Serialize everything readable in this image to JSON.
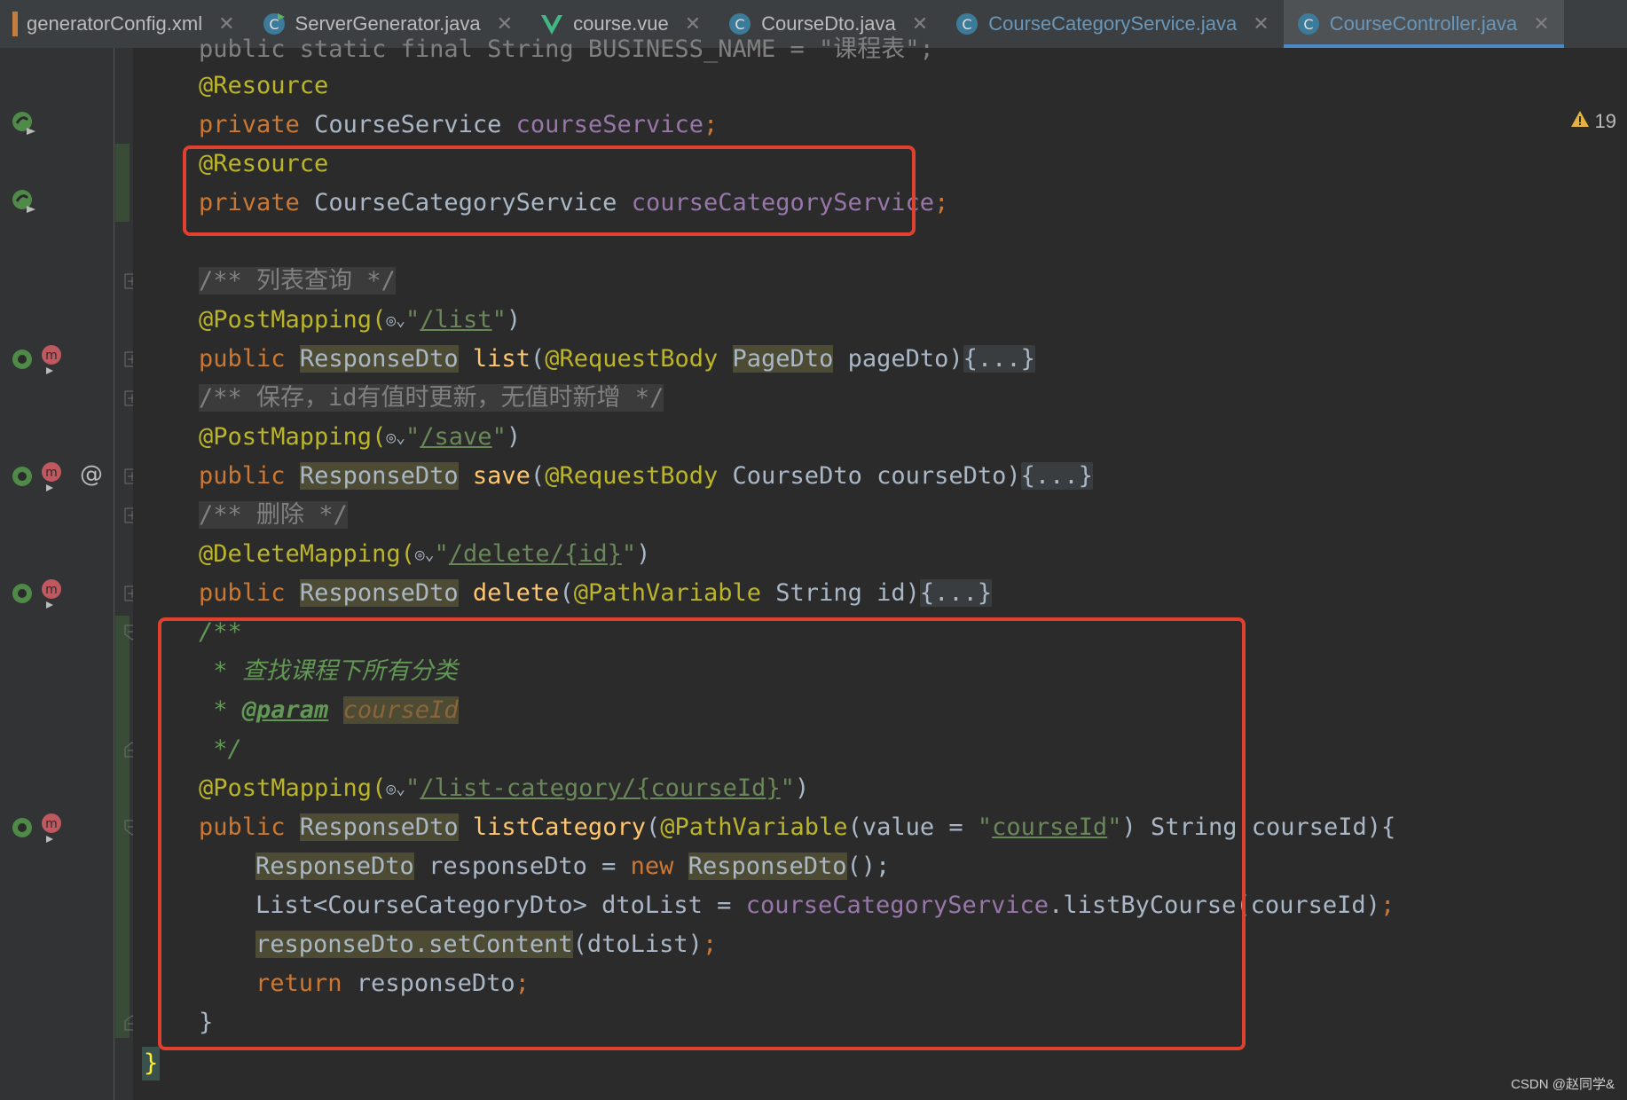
{
  "tabs": [
    {
      "label": "generatorConfig.xml",
      "icon": "xml-file-icon"
    },
    {
      "label": "ServerGenerator.java",
      "icon": "java-runnable-icon"
    },
    {
      "label": "course.vue",
      "icon": "vue-file-icon"
    },
    {
      "label": "CourseDto.java",
      "icon": "java-class-icon"
    },
    {
      "label": "CourseCategoryService.java",
      "icon": "java-class-icon"
    },
    {
      "label": "CourseController.java",
      "icon": "java-class-icon"
    }
  ],
  "close_glyph": "✕",
  "warnings_count": "19",
  "code": {
    "l0": "public static final String BUSINESS_NAME = \"课程表\";",
    "l1_ann": "@Resource",
    "l2_kw": "private",
    "l2_type": "CourseService",
    "l2_fld": "courseService",
    "l3_ann": "@Resource",
    "l4_kw": "private",
    "l4_type": "CourseCategoryService",
    "l4_fld": "courseCategoryService",
    "l5_cmt": "/** 列表查询 */",
    "l6_ann": "@PostMapping(",
    "l6_url": "/list",
    "l7_kw": "public",
    "l7_type": "ResponseDto",
    "l7_mth": "list",
    "l7_ann": "@RequestBody",
    "l7_ptype": "PageDto",
    "l7_rest": "pageDto)",
    "fold_body": "{...}",
    "l8_cmt": "/** 保存，id有值时更新，无值时新增 */",
    "l9_ann": "@PostMapping(",
    "l9_url": "/save",
    "l10_kw": "public",
    "l10_type": "ResponseDto",
    "l10_mth": "save",
    "l10_ann": "@RequestBody",
    "l10_rest": "CourseDto courseDto)",
    "l11_cmt": "/** 删除 */",
    "l12_ann": "@DeleteMapping(",
    "l12_url": "/delete/{id}",
    "l13_kw": "public",
    "l13_type": "ResponseDto",
    "l13_mth": "delete",
    "l13_ann": "@PathVariable",
    "l13_rest": "String id)",
    "l14_doc": "/**",
    "l15_doc": " * 查找课程下所有分类",
    "l16_star": " * ",
    "l16_tag": "@param",
    "l16_name": "courseId",
    "l17_doc": " */",
    "l18_ann": "@PostMapping(",
    "l18_url": "/list-category/{courseId}",
    "l19_kw": "public",
    "l19_type": "ResponseDto",
    "l19_mth": "listCategory",
    "l19_ann": "@PathVariable",
    "l19_mid": "(value = ",
    "l19_str": "courseId",
    "l19_rest": ") String courseId){",
    "l20_type": "ResponseDto",
    "l20_mid": " responseDto = ",
    "l20_kw": "new",
    "l20_type2": "ResponseDto",
    "l20_end": "();",
    "l21_a": "List<CourseCategoryDto> dtoList = ",
    "l21_fld": "courseCategoryService",
    "l21_b": ".listByCourse(courseId)",
    "l21_semi": ";",
    "l22_a": "responseDto.setContent",
    "l22_b": "(dtoList)",
    "l22_semi": ";",
    "l23_kw": "return",
    "l23_rest": " responseDto",
    "l23_semi": ";",
    "l24": "}",
    "l25": "}"
  },
  "watermark": "CSDN @赵同学&",
  "colors": {
    "keyword": "#cc7832",
    "annotation": "#bbb529",
    "field": "#9876aa",
    "string": "#6a8759",
    "method": "#ffc66d",
    "highlight_box": "#e0412f"
  }
}
